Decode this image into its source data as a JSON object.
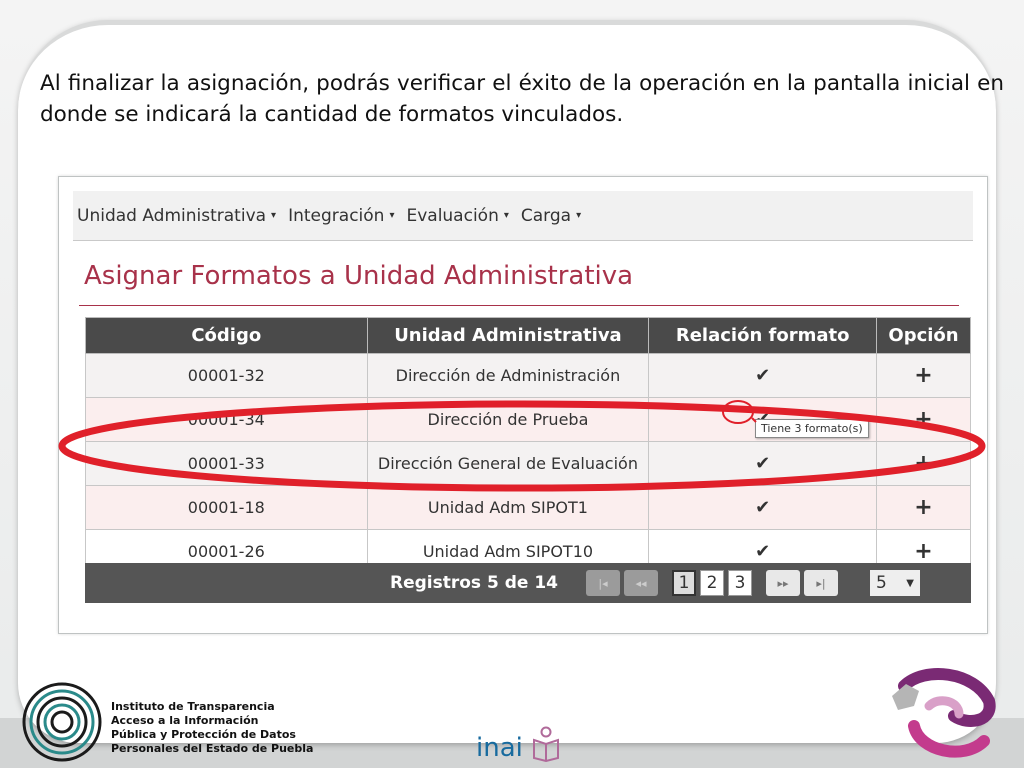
{
  "intro_text": "Al finalizar la asignación, podrás verificar el éxito de la operación en la pantalla inicial en donde se indicará la cantidad de formatos vinculados.",
  "nav": [
    {
      "label": "Unidad Administrativa"
    },
    {
      "label": "Integración"
    },
    {
      "label": "Evaluación"
    },
    {
      "label": "Carga"
    }
  ],
  "page_title": "Asignar Formatos a Unidad Administrativa",
  "table": {
    "headers": [
      "Código",
      "Unidad Administrativa",
      "Relación formato",
      "Opción"
    ],
    "rows": [
      {
        "code": "00001-32",
        "unit": "Dirección de Administración"
      },
      {
        "code": "00001-34",
        "unit": "Dirección de Prueba"
      },
      {
        "code": "00001-33",
        "unit": "Dirección General de Evaluación"
      },
      {
        "code": "00001-18",
        "unit": "Unidad Adm SIPOT1"
      },
      {
        "code": "00001-26",
        "unit": "Unidad Adm SIPOT10"
      }
    ]
  },
  "tooltip": "Tiene 3 formato(s)",
  "pager": {
    "label": "Registros 5 de 14",
    "first": "|◂",
    "prev": "◂◂",
    "next": "▸▸",
    "last": "▸|",
    "pages": [
      "1",
      "2",
      "3"
    ],
    "page_size": "5",
    "caret": "▼"
  },
  "footer": {
    "line1": "Instituto de Transparencia",
    "line2": "Acceso a la Información",
    "line3": "Pública y Protección de Datos",
    "line4": "Personales del Estado de Puebla",
    "inai": "inai"
  },
  "icons": {
    "check": "✔",
    "plus": "+",
    "caret": "▾"
  },
  "colors": {
    "title": "#a8324a",
    "highlight": "#e0202a",
    "header": "#4a4a4a"
  }
}
